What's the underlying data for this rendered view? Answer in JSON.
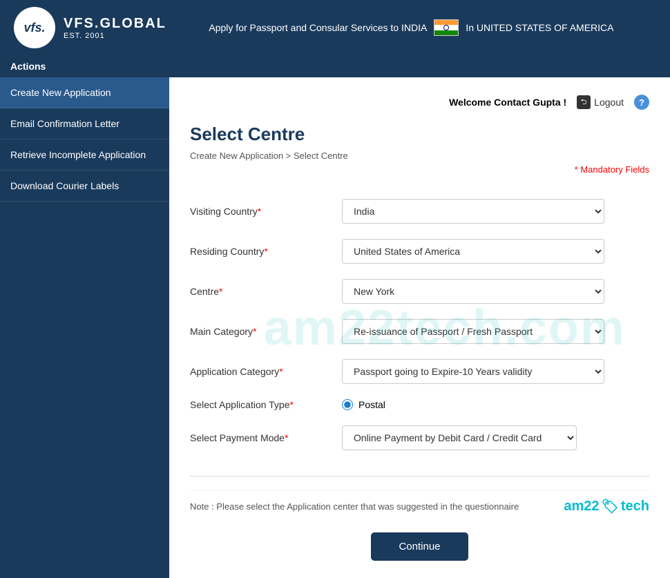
{
  "header": {
    "logo_text": "vfs.",
    "brand_main": "VFS.GLOBAL",
    "brand_sub": "EST. 2001",
    "tagline": "Apply for Passport and Consular Services to INDIA",
    "country": "In UNITED STATES OF AMERICA"
  },
  "actions_title": "Actions",
  "sidebar": {
    "items": [
      {
        "id": "create-new",
        "label": "Create New Application",
        "active": true
      },
      {
        "id": "email-confirm",
        "label": "Email Confirmation Letter",
        "active": false
      },
      {
        "id": "retrieve",
        "label": "Retrieve Incomplete Application",
        "active": false
      },
      {
        "id": "download",
        "label": "Download Courier Labels",
        "active": false
      }
    ]
  },
  "userbar": {
    "welcome": "Welcome Contact Gupta !",
    "logout": "Logout",
    "help": "?"
  },
  "page": {
    "title": "Select Centre",
    "breadcrumb_part1": "Create New Application",
    "breadcrumb_sep": " > ",
    "breadcrumb_part2": "Select Centre",
    "mandatory_note": "Mandatory Fields",
    "mandatory_star": "*"
  },
  "form": {
    "visiting_country_label": "Visiting Country",
    "visiting_country_value": "India",
    "residing_country_label": "Residing Country",
    "residing_country_value": "United States of America",
    "centre_label": "Centre",
    "centre_value": "New York",
    "main_category_label": "Main Category",
    "main_category_value": "Re-issuance of Passport / Fresh Passport",
    "app_category_label": "Application Category",
    "app_category_value": "Passport going to Expire-10 Years validity",
    "app_type_label": "Select Application Type",
    "app_type_value": "Postal",
    "payment_mode_label": "Select Payment Mode",
    "payment_mode_value": "Online Payment by Debit Card / Credit Card",
    "req_marker": "*"
  },
  "note": {
    "text": "Note : Please select the Application center that was suggested in the questionnaire"
  },
  "watermark": "am22tech.com",
  "footer": {
    "continue_label": "Continue"
  },
  "am22tech": {
    "label": "am22",
    "tech": "tech",
    "icon": "🏷"
  }
}
